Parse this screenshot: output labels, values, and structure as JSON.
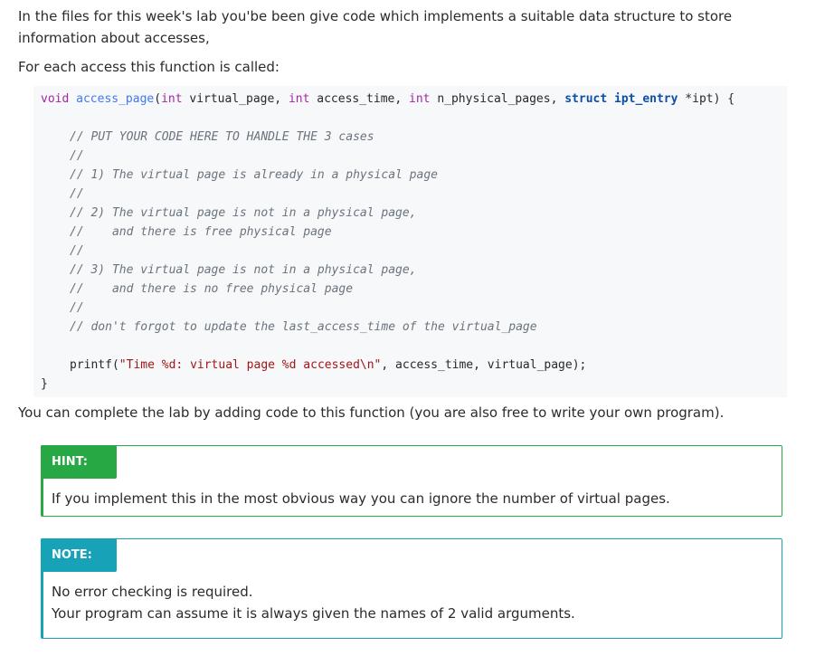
{
  "intro": "In the files for this week's lab you'be been give code which implements a suitable data structure to store information about accesses,",
  "for_each": "For each access this function is called:",
  "code": {
    "sig": {
      "void": "void",
      "fname": "access_page",
      "p1_type": "int",
      "p1_name": "virtual_page",
      "p2_type": "int",
      "p2_name": "access_time",
      "p3_type": "int",
      "p3_name": "n_physical_pages",
      "struct": "struct",
      "struct_name": "ipt_entry",
      "p4_name": "*ipt"
    },
    "comments": [
      "// PUT YOUR CODE HERE TO HANDLE THE 3 cases",
      "//",
      "// 1) The virtual page is already in a physical page",
      "//",
      "// 2) The virtual page is not in a physical page,",
      "//    and there is free physical page",
      "//",
      "// 3) The virtual page is not in a physical page,",
      "//    and there is no free physical page",
      "//",
      "// don't forgot to update the last_access_time of the virtual_page"
    ],
    "printf_fn": "printf",
    "printf_str": "\"Time %d: virtual page %d accessed\\n\"",
    "printf_args": ", access_time, virtual_page);",
    "close_brace": "}"
  },
  "complete": "You can complete the lab by adding code to this function (you are also free to write your own program).",
  "hint": {
    "title": "HINT:",
    "text": "If you implement this in the most obvious way you can ignore the number of virtual pages."
  },
  "note": {
    "title": "NOTE:",
    "lines": [
      "No error checking is required.",
      "Your program can assume it is always given the names of 2 valid arguments."
    ]
  },
  "colors": {
    "hint_accent": "#28a745",
    "note_accent": "#17a2b8",
    "code_bg": "#f6f8fa"
  }
}
